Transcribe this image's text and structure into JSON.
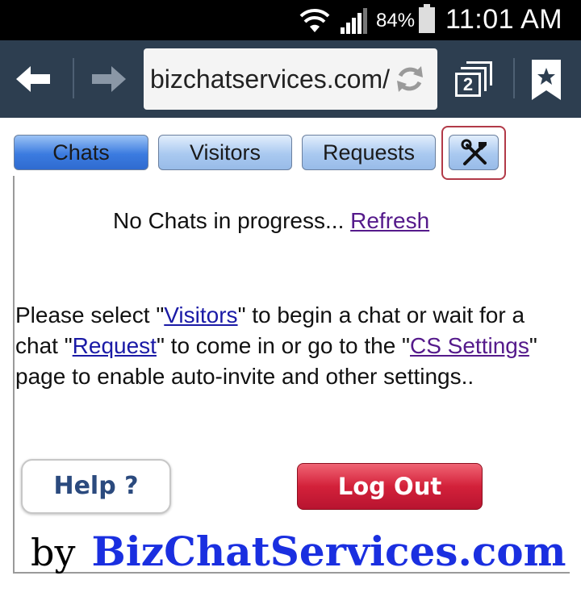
{
  "status_bar": {
    "battery": "84%",
    "time": "11:01 AM"
  },
  "browser": {
    "url": "bizchatservices.com/",
    "tab_count": "2"
  },
  "nav_tabs": [
    {
      "label": "Chats"
    },
    {
      "label": "Visitors"
    },
    {
      "label": "Requests"
    }
  ],
  "settings_tab": {
    "icon": "tools-icon"
  },
  "status": {
    "message": "No Chats in progress... ",
    "refresh_link": "Refresh"
  },
  "instructions": {
    "part1": "Please select \"",
    "visitors_link": "Visitors",
    "part2": "\" to begin a chat or wait for a chat \"",
    "request_link": "Request",
    "part3": "\" to come in or go to the \"",
    "cs_settings_link": "CS Settings",
    "part4": "\" page to enable auto-invite and other settings.."
  },
  "buttons": {
    "help": "Help ?",
    "logout": "Log Out"
  },
  "footer": {
    "by": "by",
    "brand": "BizChatServices.com"
  },
  "colors": {
    "toolbar": "#2d3e50",
    "brand": "#1a2fe0",
    "logout": "#d3213a",
    "settings_highlight": "#b23a48"
  }
}
